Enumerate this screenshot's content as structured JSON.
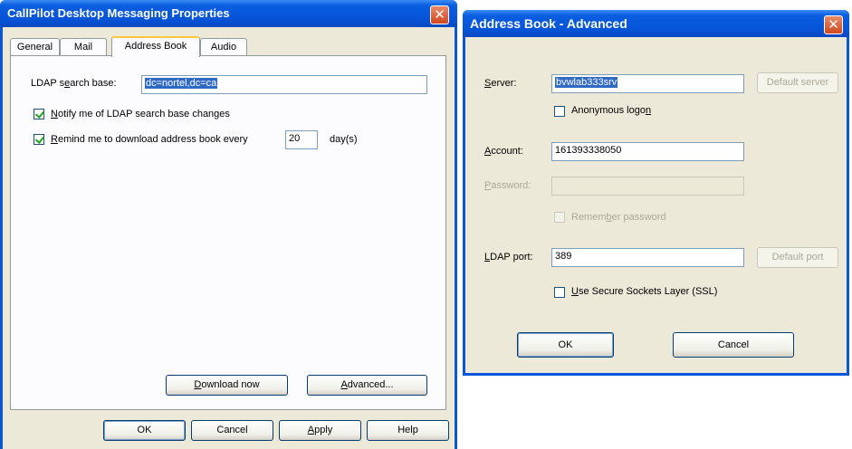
{
  "dialog1": {
    "title": "CallPilot Desktop Messaging Properties",
    "tabs": [
      {
        "label": "General"
      },
      {
        "label": "Mail"
      },
      {
        "label": "Address Book"
      },
      {
        "label": "Audio"
      }
    ],
    "active_tab": "Address Book",
    "ldap_base_label_pre": "LDAP s",
    "ldap_base_label_acc": "e",
    "ldap_base_label_post": "arch base:",
    "ldap_base_value": "dc=nortel,dc=ca",
    "notify_acc": "N",
    "notify_rest": "otify me of LDAP search base changes",
    "notify_checked": true,
    "remind_acc": "R",
    "remind_rest": "emind me to download address book every",
    "remind_checked": true,
    "remind_days": "20",
    "remind_unit": "day(s)",
    "download_acc": "D",
    "download_rest": "ownload now",
    "advanced_acc": "A",
    "advanced_rest": "dvanced...",
    "ok": "OK",
    "cancel": "Cancel",
    "apply_acc": "A",
    "apply_rest": "pply",
    "help": "Help",
    "close_glyph": "✕"
  },
  "dialog2": {
    "title": "Address Book - Advanced",
    "server_acc": "S",
    "server_rest": "erver:",
    "server_value": "bvwlab333srv",
    "default_server": "Default server",
    "anon_pre": "Anonymous logo",
    "anon_acc": "n",
    "anon_checked": false,
    "account_acc": "A",
    "account_rest": "ccount:",
    "account_value": "161393338050",
    "password_acc": "P",
    "password_rest": "assword:",
    "password_value": "",
    "remember_pre": "Remem",
    "remember_acc": "b",
    "remember_post": "er password",
    "ldap_port_acc": "L",
    "ldap_port_rest": "DAP port:",
    "ldap_port_value": "389",
    "default_port": "Default port",
    "ssl_acc": "U",
    "ssl_rest": "se Secure Sockets Layer (SSL)",
    "ssl_checked": false,
    "ok": "OK",
    "cancel": "Cancel",
    "close_glyph": "✕"
  },
  "colors": {
    "titlebar": "#0654d8",
    "dialog_face": "#ece9d8",
    "selection": "#316ac5",
    "close_button": "#d0481e"
  }
}
